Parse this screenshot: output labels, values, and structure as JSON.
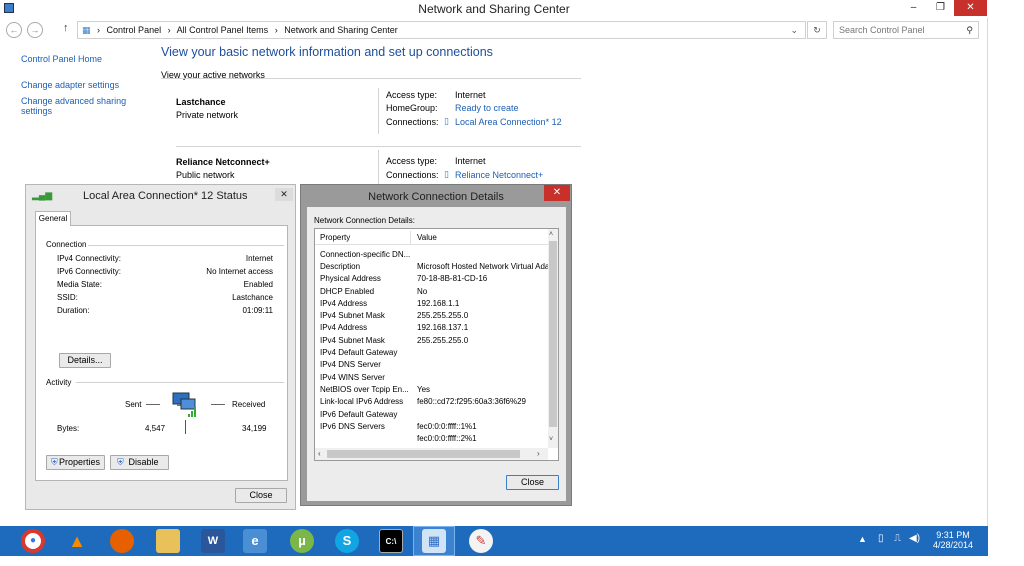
{
  "window": {
    "title": "Network and Sharing Center",
    "minimize": "–",
    "restore": "❐",
    "close": "✕"
  },
  "address": {
    "items": [
      "Control Panel",
      "All Control Panel Items",
      "Network and Sharing Center"
    ],
    "sep": "›",
    "search_placeholder": "Search Control Panel"
  },
  "sidebar": {
    "home": "Control Panel Home",
    "items": [
      "Change adapter settings",
      "Change advanced sharing settings"
    ]
  },
  "main": {
    "heading": "View your basic network information and set up connections",
    "active_networks": "View your active networks",
    "net1": {
      "name": "Lastchance",
      "type": "Private network",
      "access_label": "Access type:",
      "access": "Internet",
      "homegroup_label": "HomeGroup:",
      "homegroup": "Ready to create",
      "conn_label": "Connections:",
      "conn": "Local Area Connection* 12"
    },
    "net2": {
      "name": "Reliance Netconnect+",
      "type": "Public network",
      "access_label": "Access type:",
      "access": "Internet",
      "conn_label": "Connections:",
      "conn": "Reliance Netconnect+"
    }
  },
  "status_dialog": {
    "title": "Local Area Connection* 12 Status",
    "tab": "General",
    "connection_label": "Connection",
    "rows": [
      {
        "k": "IPv4 Connectivity:",
        "v": "Internet"
      },
      {
        "k": "IPv6 Connectivity:",
        "v": "No Internet access"
      },
      {
        "k": "Media State:",
        "v": "Enabled"
      },
      {
        "k": "SSID:",
        "v": "Lastchance"
      },
      {
        "k": "Duration:",
        "v": "01:09:11"
      }
    ],
    "details": "Details...",
    "activity": "Activity",
    "sent": "Sent",
    "received": "Received",
    "bytes_label": "Bytes:",
    "bytes_sent": "4,547",
    "bytes_received": "34,199",
    "properties": "Properties",
    "disable": "Disable",
    "close": "Close"
  },
  "details_dialog": {
    "title": "Network Connection Details",
    "label": "Network Connection Details:",
    "col_property": "Property",
    "col_value": "Value",
    "rows": [
      {
        "p": "Connection-specific DN...",
        "v": ""
      },
      {
        "p": "Description",
        "v": "Microsoft Hosted Network Virtual Adap"
      },
      {
        "p": "Physical Address",
        "v": "70-18-8B-81-CD-16"
      },
      {
        "p": "DHCP Enabled",
        "v": "No"
      },
      {
        "p": "IPv4 Address",
        "v": "192.168.1.1"
      },
      {
        "p": "IPv4 Subnet Mask",
        "v": "255.255.255.0"
      },
      {
        "p": "IPv4 Address",
        "v": "192.168.137.1"
      },
      {
        "p": "IPv4 Subnet Mask",
        "v": "255.255.255.0"
      },
      {
        "p": "IPv4 Default Gateway",
        "v": ""
      },
      {
        "p": "IPv4 DNS Server",
        "v": ""
      },
      {
        "p": "IPv4 WINS Server",
        "v": ""
      },
      {
        "p": "NetBIOS over Tcpip En...",
        "v": "Yes"
      },
      {
        "p": "Link-local IPv6 Address",
        "v": "fe80::cd72:f295:60a3:36f6%29"
      },
      {
        "p": "IPv6 Default Gateway",
        "v": ""
      },
      {
        "p": "IPv6 DNS Servers",
        "v": "fec0:0:0:ffff::1%1"
      },
      {
        "p": "",
        "v": "fec0:0:0:ffff::2%1"
      }
    ],
    "close": "Close"
  },
  "taskbar": {
    "time": "9:31 PM",
    "date": "4/28/2014",
    "icons": [
      "chrome-icon",
      "vlc-icon",
      "firefox-icon",
      "explorer-icon",
      "word-icon",
      "ie-icon",
      "utorrent-icon",
      "skype-icon",
      "cmd-icon",
      "control-panel-icon",
      "paint-icon"
    ]
  }
}
